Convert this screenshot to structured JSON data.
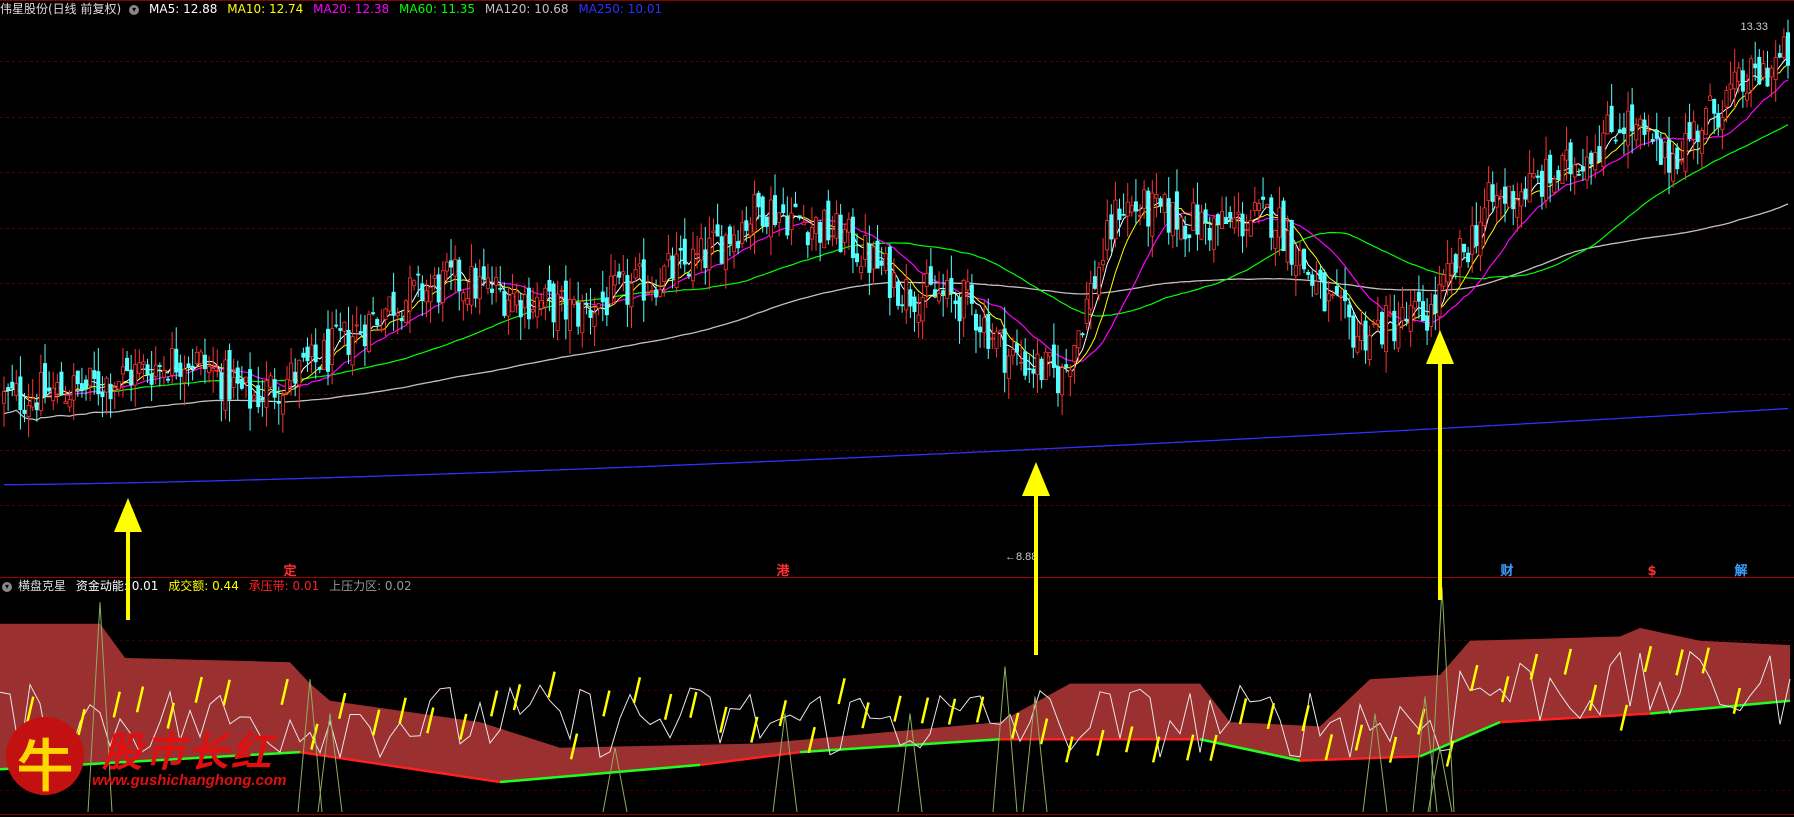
{
  "header": {
    "stock": "伟星股份(日线 前复权)",
    "ma": [
      {
        "label": "MA5: 12.88",
        "color": "#ffffff"
      },
      {
        "label": "MA10: 12.74",
        "color": "#ffff00"
      },
      {
        "label": "MA20: 12.38",
        "color": "#ff00ff"
      },
      {
        "label": "MA60: 11.35",
        "color": "#00ff00"
      },
      {
        "label": "MA120: 10.68",
        "color": "#c0c0c0"
      },
      {
        "label": "MA250: 10.01",
        "color": "#3030ff"
      }
    ]
  },
  "indicator": {
    "name": "横盘克星",
    "items": [
      {
        "label": "资金动能: 0.01",
        "color": "#ffffff"
      },
      {
        "label": "成交额: 0.44",
        "color": "#ffff00"
      },
      {
        "label": "承压带: 0.01",
        "color": "#ff2020"
      },
      {
        "label": "上压力区: 0.02",
        "color": "#999999"
      }
    ]
  },
  "chart_data": {
    "type": "candlestick",
    "price_annotations": {
      "high": "13.33",
      "low": "8.88"
    },
    "event_markers": [
      {
        "label": "定",
        "color": "#ff3030"
      },
      {
        "label": "港",
        "color": "#ff3030"
      },
      {
        "label": "财",
        "color": "#3aa0ff"
      },
      {
        "label": "$",
        "color": "#ff3030"
      },
      {
        "label": "解",
        "color": "#3aa0ff"
      }
    ],
    "ohlc_knots": [
      [
        0,
        10.1
      ],
      [
        20,
        10.2
      ],
      [
        45,
        10.5
      ],
      [
        60,
        10.1
      ],
      [
        75,
        10.4
      ],
      [
        95,
        11.0
      ],
      [
        110,
        11.2
      ],
      [
        140,
        10.9
      ],
      [
        170,
        11.4
      ],
      [
        185,
        11.9
      ],
      [
        205,
        11.6
      ],
      [
        220,
        11.1
      ],
      [
        235,
        11.0
      ],
      [
        245,
        10.5
      ],
      [
        258,
        10.3
      ],
      [
        272,
        11.9
      ],
      [
        295,
        11.7
      ],
      [
        310,
        11.8
      ],
      [
        322,
        11.0
      ],
      [
        330,
        10.7
      ],
      [
        348,
        10.9
      ],
      [
        362,
        11.9
      ],
      [
        380,
        12.2
      ],
      [
        395,
        12.7
      ],
      [
        405,
        12.3
      ],
      [
        420,
        12.9
      ],
      [
        435,
        13.3
      ]
    ],
    "ylim": [
      8.6,
      13.6
    ]
  },
  "watermark": {
    "logo_char": "牛",
    "title": "股市长红",
    "url": "www.gushichanghong.com"
  }
}
